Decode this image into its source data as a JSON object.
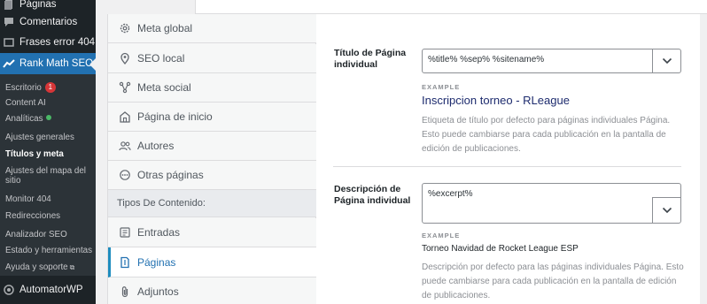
{
  "sidebar": {
    "menu": [
      {
        "label": "Páginas",
        "icon": "pages-icon"
      },
      {
        "label": "Comentarios",
        "icon": "comments-icon"
      },
      {
        "label": "Frases error 404",
        "icon": "error-phrases-icon"
      },
      {
        "label": "Rank Math SEO",
        "icon": "rank-math-icon"
      }
    ],
    "submenu": [
      {
        "label": "Escritorio",
        "badge": "1"
      },
      {
        "label": "Content AI"
      },
      {
        "label": "Analíticas"
      },
      {
        "label": "Ajustes generales"
      },
      {
        "label": "Títulos y meta"
      },
      {
        "label": "Ajustes del mapa del sitio"
      },
      {
        "label": "Monitor 404"
      },
      {
        "label": "Redirecciones"
      },
      {
        "label": "Analizador SEO"
      },
      {
        "label": "Estado y herramientas"
      },
      {
        "label": "Ayuda y soporte"
      }
    ],
    "bottom": {
      "label": "AutomatorWP",
      "icon": "automatorwp-icon"
    }
  },
  "nav": {
    "items": [
      {
        "label": "Meta global",
        "icon": "gear-icon"
      },
      {
        "label": "SEO local",
        "icon": "location-pin-icon"
      },
      {
        "label": "Meta social",
        "icon": "social-network-icon"
      },
      {
        "label": "Página de inicio",
        "icon": "home-icon"
      },
      {
        "label": "Autores",
        "icon": "users-icon"
      },
      {
        "label": "Otras páginas",
        "icon": "other-pages-icon"
      }
    ],
    "section_heading": "Tipos De Contenido:",
    "types": [
      {
        "label": "Entradas",
        "icon": "post-icon"
      },
      {
        "label": "Páginas",
        "icon": "page-icon"
      },
      {
        "label": "Adjuntos",
        "icon": "attachment-icon"
      }
    ]
  },
  "fields": {
    "title": {
      "label": "Título de Página individual",
      "value": "%title% %sep% %sitename%",
      "example_label": "EXAMPLE",
      "example_value": "Inscripcion torneo - RLeague",
      "description": "Etiqueta de título por defecto para páginas individuales Página. Esto puede cambiarse para cada publicación en la pantalla de edición de publicaciones."
    },
    "description": {
      "label": "Descripción de Página individual",
      "value": "%excerpt%",
      "example_label": "EXAMPLE",
      "example_value": "Torneo Navidad de Rocket League ESP",
      "description": "Descripción por defecto para las páginas individuales Página. Esto puede cambiarse para cada publicación en la pantalla de edición de publicaciones."
    }
  },
  "colors": {
    "admin_bg": "#1d2327",
    "accent": "#2271b1",
    "example_link": "#1d2b6e"
  }
}
